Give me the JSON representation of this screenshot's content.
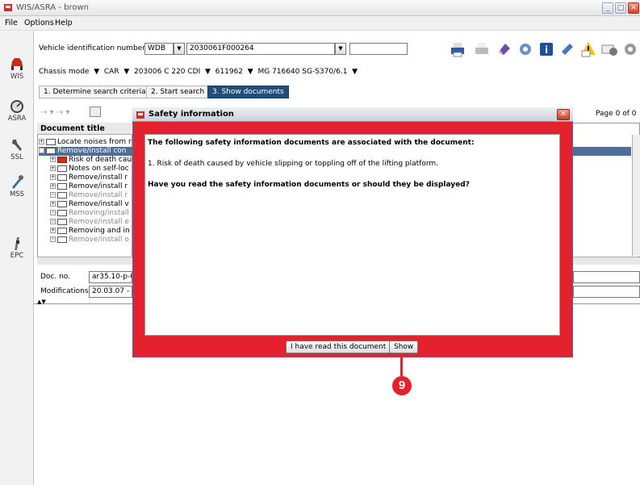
{
  "window": {
    "title": "WIS/ASRA - brown"
  },
  "menu": [
    "File",
    "Options",
    "Help"
  ],
  "leftnav": [
    "WIS",
    "ASRA",
    "SSL",
    "MSS",
    "EPC"
  ],
  "vin": {
    "label": "Vehicle identification number",
    "prefix": "WDB",
    "value": "2030061F000264"
  },
  "chassis_row": {
    "mode": "Chassis mode",
    "car": "CAR",
    "model": "203006 C 220 CDI",
    "code": "611962",
    "transmission": "MG 716640 SG-S370/6.1"
  },
  "tabs": [
    "1. Determine search criteria",
    "2. Start search",
    "3. Show documents"
  ],
  "page_indicator": "Page 0 of 0",
  "document_tree": {
    "header": "Document title",
    "items": [
      "Locate noises from r",
      "Remove/install con",
      "Risk of death cau",
      "Notes on self-loc",
      "Remove/install r",
      "Remove/install r",
      "Remove/install r",
      "Remove/install v",
      "Removing/install",
      "Remove/install e",
      "Removing and in",
      "Remove/install o"
    ]
  },
  "doc_info": {
    "doc_no_label": "Doc. no.",
    "doc_no_value": "ar35.10-p-00",
    "modifications_label": "Modifications",
    "modifications_value": "20.03.07 - W"
  },
  "dialog": {
    "title": "Safety information",
    "heading": "The following safety information documents are associated with the document:",
    "item": "1. Risk of death caused by vehicle slipping or toppling off of the lifting platform.",
    "question": "Have you read the safety information documents or should they be displayed?",
    "btn_read": "I have read this document",
    "btn_show": "Show"
  },
  "callout": "9",
  "colors": {
    "dialog_bg": "#e5212e",
    "active_tab": "#1f4e79",
    "selection": "#4e6f98"
  }
}
